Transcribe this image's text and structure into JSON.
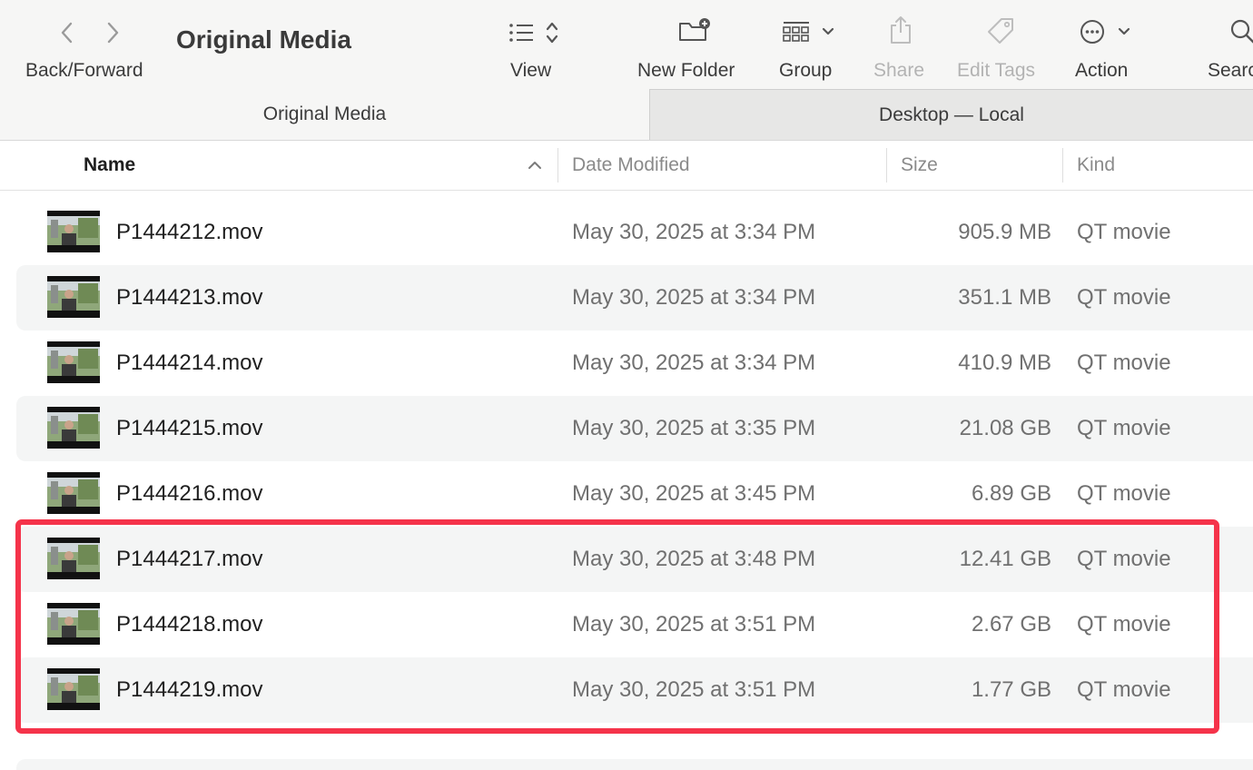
{
  "toolbar": {
    "back_forward_label": "Back/Forward",
    "title": "Original Media",
    "view_label": "View",
    "new_folder_label": "New Folder",
    "group_label": "Group",
    "share_label": "Share",
    "edit_tags_label": "Edit Tags",
    "action_label": "Action",
    "search_label": "Search"
  },
  "tabs": {
    "active": "Original Media",
    "inactive": "Desktop — Local"
  },
  "columns": {
    "name": "Name",
    "date": "Date Modified",
    "size": "Size",
    "kind": "Kind"
  },
  "files": [
    {
      "name": "P1444212.mov",
      "date": "May 30, 2025 at 3:34 PM",
      "size": "905.9 MB",
      "kind": "QT movie"
    },
    {
      "name": "P1444213.mov",
      "date": "May 30, 2025 at 3:34 PM",
      "size": "351.1 MB",
      "kind": "QT movie"
    },
    {
      "name": "P1444214.mov",
      "date": "May 30, 2025 at 3:34 PM",
      "size": "410.9 MB",
      "kind": "QT movie"
    },
    {
      "name": "P1444215.mov",
      "date": "May 30, 2025 at 3:35 PM",
      "size": "21.08 GB",
      "kind": "QT movie"
    },
    {
      "name": "P1444216.mov",
      "date": "May 30, 2025 at 3:45 PM",
      "size": "6.89 GB",
      "kind": "QT movie"
    },
    {
      "name": "P1444217.mov",
      "date": "May 30, 2025 at 3:48 PM",
      "size": "12.41 GB",
      "kind": "QT movie"
    },
    {
      "name": "P1444218.mov",
      "date": "May 30, 2025 at 3:51 PM",
      "size": "2.67 GB",
      "kind": "QT movie"
    },
    {
      "name": "P1444219.mov",
      "date": "May 30, 2025 at 3:51 PM",
      "size": "1.77 GB",
      "kind": "QT movie"
    }
  ],
  "colors": {
    "highlight": "#f5334a",
    "alt_row": "#f4f5f5",
    "toolbar_bg": "#f6f6f5"
  },
  "icons": [
    "chevron-left-icon",
    "chevron-right-icon",
    "list-view-icon",
    "sort-updown-icon",
    "new-folder-icon",
    "group-grid-icon",
    "chevron-down-icon",
    "share-icon",
    "tag-icon",
    "ellipsis-circle-icon",
    "search-icon",
    "sort-ascending-icon",
    "video-thumbnail-icon"
  ]
}
